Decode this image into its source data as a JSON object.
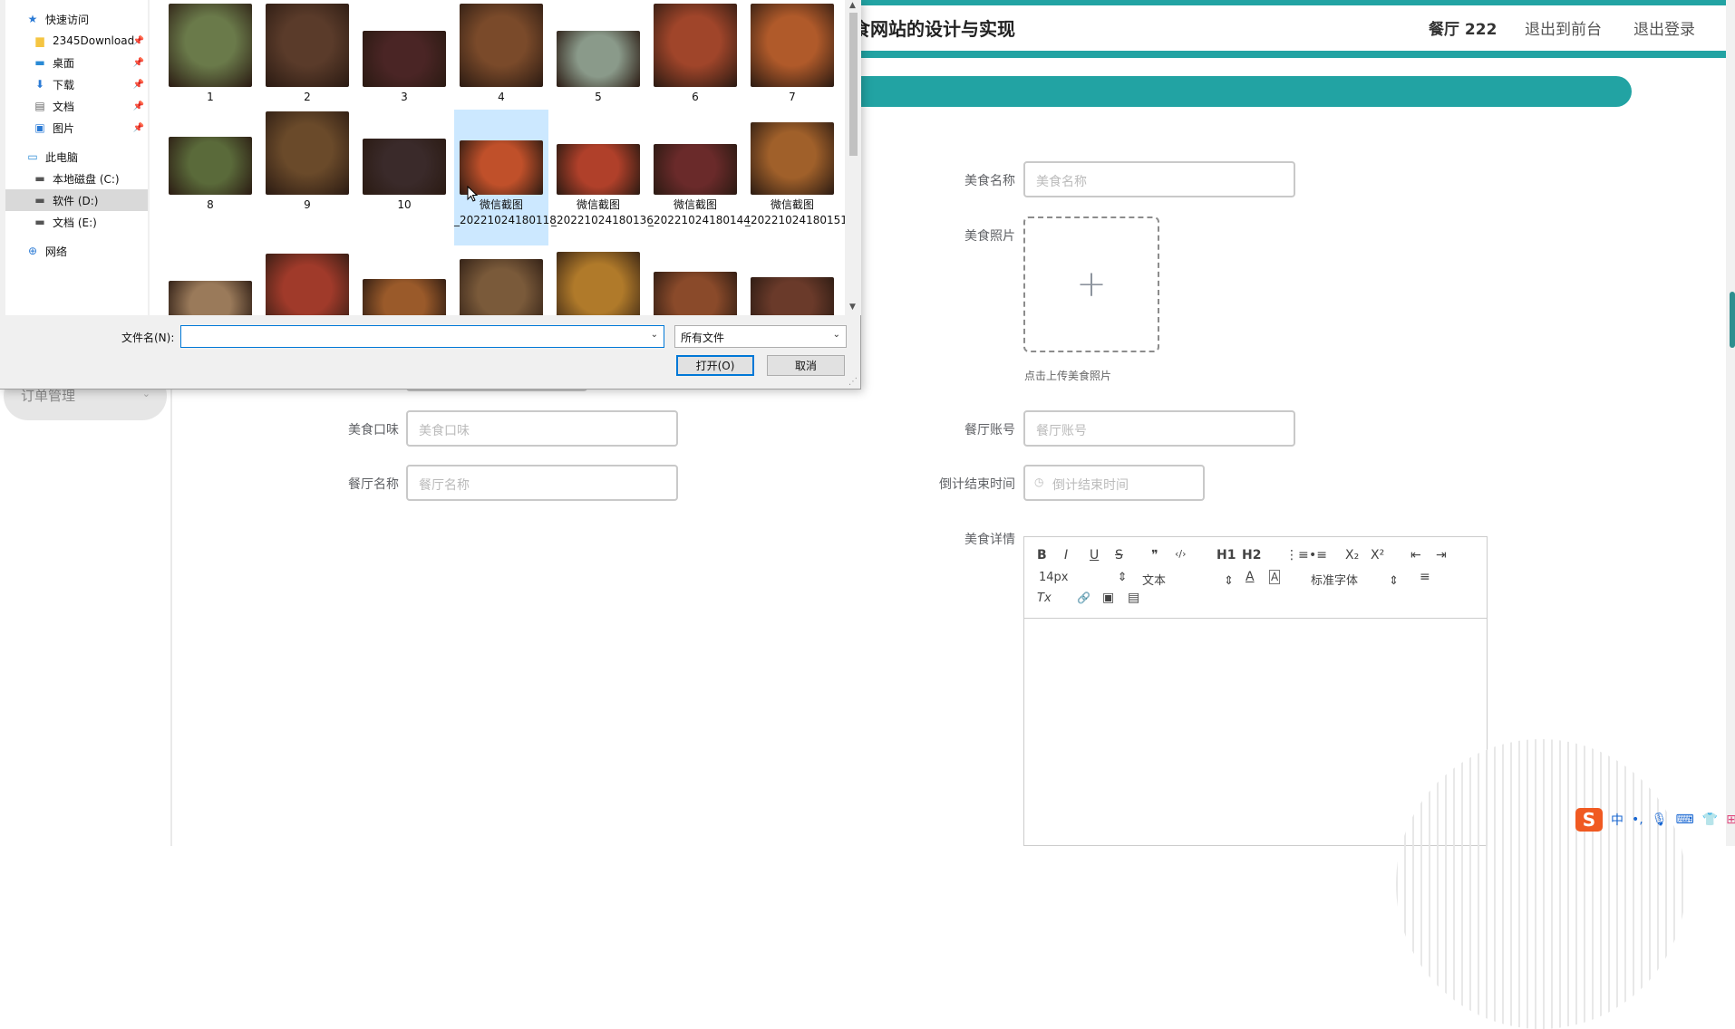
{
  "header": {
    "site_title": "食网站的设计与实现",
    "user": "餐厅 222",
    "back_to_front": "退出到前台",
    "logout": "退出登录"
  },
  "sidebar": {
    "order_menu": "订单管理"
  },
  "form": {
    "food_name_label": "美食名称",
    "food_name_placeholder": "美食名称",
    "food_photo_label": "美食照片",
    "upload_tip": "点击上传美食照片",
    "food_taste_label": "美食口味",
    "food_taste_placeholder": "美食口味",
    "restaurant_account_label": "餐厅账号",
    "restaurant_account_placeholder": "餐厅账号",
    "restaurant_name_label": "餐厅名称",
    "restaurant_name_placeholder": "餐厅名称",
    "countdown_label": "倒计结束时间",
    "countdown_placeholder": "倒计结束时间",
    "details_label": "美食详情"
  },
  "editor": {
    "bold": "B",
    "italic": "I",
    "underline": "U",
    "strike": "S",
    "quote": "❞",
    "code": "‹/›",
    "h1": "H1",
    "h2": "H2",
    "ordered_list": "⋮≡",
    "bullet_list": "•≡",
    "subscript": "X₂",
    "superscript": "X²",
    "outdent": "⇤",
    "indent": "⇥",
    "font_size": "14px",
    "text_style": "文本",
    "font_family": "标准字体",
    "font_color": "A",
    "bg_color": "A",
    "align": "≡",
    "clear_format": "Tx",
    "link": "🔗",
    "image": "▣",
    "video": "▤"
  },
  "dialog": {
    "nav": [
      {
        "label": "快速访问",
        "icon": "star-icon",
        "pinned": false,
        "selected": false
      },
      {
        "label": "2345Download",
        "icon": "folder-icon",
        "pinned": true,
        "selected": false
      },
      {
        "label": "桌面",
        "icon": "desktop-icon",
        "pinned": true,
        "selected": false
      },
      {
        "label": "下载",
        "icon": "download-icon",
        "pinned": true,
        "selected": false
      },
      {
        "label": "文档",
        "icon": "document-icon",
        "pinned": true,
        "selected": false
      },
      {
        "label": "图片",
        "icon": "picture-icon",
        "pinned": true,
        "selected": false
      },
      {
        "label": "此电脑",
        "icon": "computer-icon",
        "pinned": false,
        "selected": false
      },
      {
        "label": "本地磁盘 (C:)",
        "icon": "drive-icon",
        "pinned": false,
        "selected": false
      },
      {
        "label": "软件 (D:)",
        "icon": "drive-icon",
        "pinned": false,
        "selected": true
      },
      {
        "label": "文档 (E:)",
        "icon": "drive-icon",
        "pinned": false,
        "selected": false
      },
      {
        "label": "网络",
        "icon": "network-icon",
        "pinned": false,
        "selected": false
      }
    ],
    "files": [
      {
        "name": "1",
        "color": "#6a7a4a"
      },
      {
        "name": "2",
        "color": "#5a3b2a"
      },
      {
        "name": "3",
        "color": "#4a2525"
      },
      {
        "name": "4",
        "color": "#7a4a2a"
      },
      {
        "name": "5",
        "color": "#8a9a8a"
      },
      {
        "name": "6",
        "color": "#a0452a"
      },
      {
        "name": "7",
        "color": "#b05a2a"
      },
      {
        "name": "8",
        "color": "#5a6a3a"
      },
      {
        "name": "9",
        "color": "#6a4a2a"
      },
      {
        "name": "10",
        "color": "#3a2a2a"
      },
      {
        "name": "微信截图_20221024180118",
        "color": "#c0502a"
      },
      {
        "name": "微信截图_20221024180136",
        "color": "#b0402a"
      },
      {
        "name": "微信截图_20221024180144",
        "color": "#6a2a2a"
      },
      {
        "name": "微信截图_20221024180151",
        "color": "#a0602a"
      },
      {
        "name": "",
        "color": "#9a7a5a"
      },
      {
        "name": "",
        "color": "#a03a2a"
      },
      {
        "name": "",
        "color": "#9a5a2a"
      },
      {
        "name": "",
        "color": "#7a5a3a"
      },
      {
        "name": "",
        "color": "#b07a2a"
      },
      {
        "name": "",
        "color": "#8a4a2a"
      },
      {
        "name": "",
        "color": "#6a3a2a"
      }
    ],
    "selected_file_index": 10,
    "filename_label": "文件名(N):",
    "filename_value": "",
    "filetype_value": "所有文件",
    "open_button": "打开(O)",
    "cancel_button": "取消"
  },
  "ime": {
    "label": "中"
  }
}
